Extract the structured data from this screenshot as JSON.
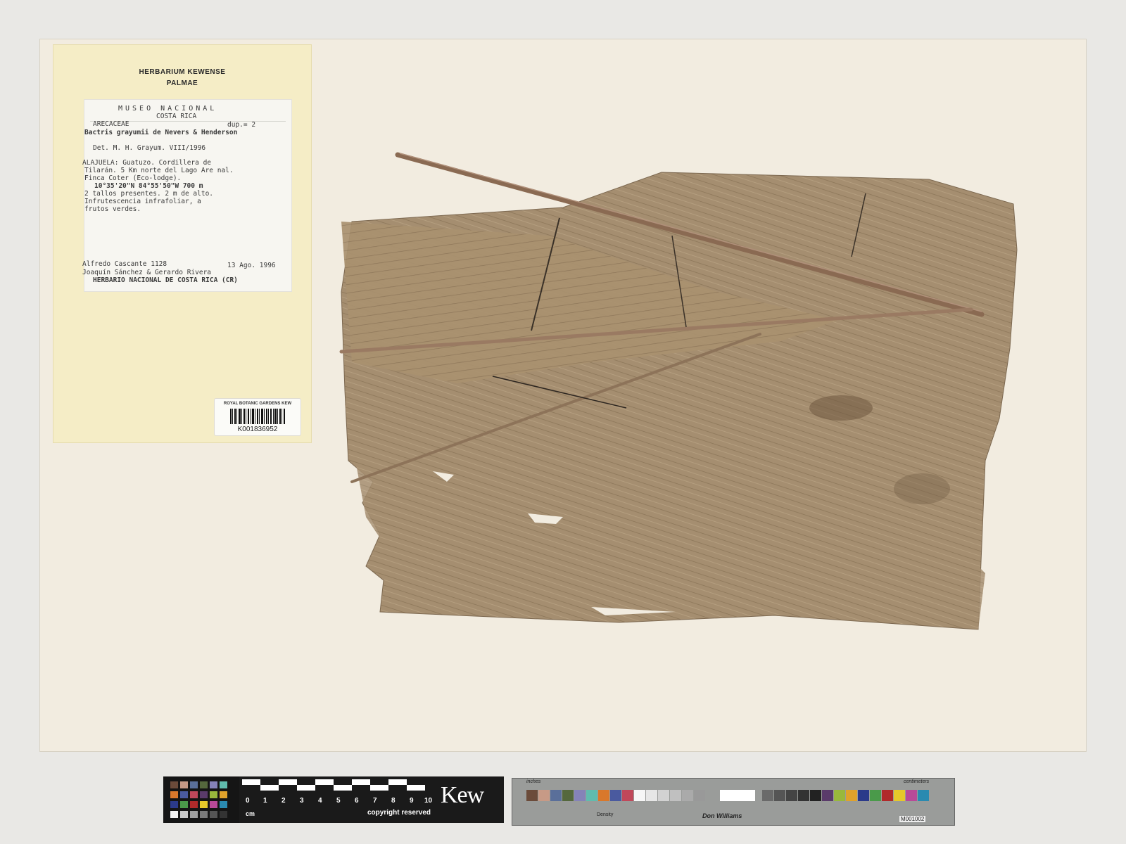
{
  "folder": {
    "line1": "HERBARIUM KEWENSE",
    "line2": "PALMAE"
  },
  "label": {
    "museum": "MUSEO NACIONAL",
    "country": "COSTA RICA",
    "family": "ARECACEAE",
    "dup": "dup.= 2",
    "species": "Bactris grayumii de Nevers & Henderson",
    "det": "Det. M. H. Grayum.   VIII/1996",
    "loc1": "ALAJUELA: Guatuzo. Cordillera de",
    "loc2": "Tilarán. 5 Km norte del Lago Are nal.",
    "loc3": "Finca Coter (Eco-lodge).",
    "coords": "10°35'20\"N 84°55'50\"W    700 m",
    "desc1": "2 tallos presentes. 2 m de alto.",
    "desc2": "Infrutescencia infrafoliar,       a",
    "desc3": "frutos verdes.",
    "collector": "Alfredo Cascante 1128",
    "date": "13 Ago. 1996",
    "others": "Joaquín Sánchez & Gerardo Rivera",
    "herbarium": "HERBARIO NACIONAL DE COSTA RICA (CR)"
  },
  "barcode": {
    "header": "ROYAL BOTANIC GARDENS KEW",
    "number": "K001836952"
  },
  "ruler": {
    "numbers": [
      "0",
      "1",
      "2",
      "3",
      "4",
      "5",
      "6",
      "7",
      "8",
      "9",
      "10"
    ],
    "unit": "cm",
    "copyright": "copyright reserved",
    "brand": "Kew"
  },
  "target": {
    "inches": "inches",
    "centimeters": "centimeters",
    "brand": "Don Williams",
    "code": "M001002",
    "density": "Density"
  },
  "colors": {
    "sheet": "#f2ece0",
    "folder": "#f5edc6",
    "leaf": "#a48d6f",
    "leaf_dark": "#7f6a51",
    "rachis": "#8a6a52"
  }
}
